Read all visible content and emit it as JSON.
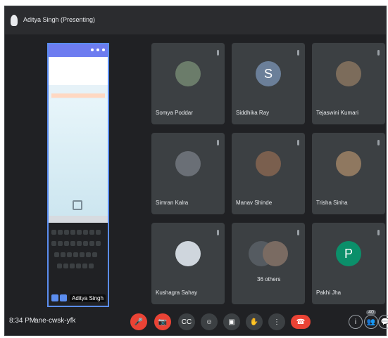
{
  "header": {
    "presenter_label": "Aditya Singh (Presenting)"
  },
  "stage": {
    "label": "Aditya Singh"
  },
  "participants": [
    {
      "name": "Somya Poddar",
      "avatar_color": "#6b7c6a"
    },
    {
      "name": "Siddhika Ray",
      "avatar_letter": "S",
      "avatar_color": "#6b7f99"
    },
    {
      "name": "Tejaswini Kumari",
      "avatar_color": "#7c6c5b"
    },
    {
      "name": "Simran Kalra",
      "avatar_color": "#6a6f76"
    },
    {
      "name": "Manav Shinde",
      "avatar_color": "#7a5f4e"
    },
    {
      "name": "Trisha Sinha",
      "avatar_color": "#8f7860"
    },
    {
      "name": "Kushagra Sahay",
      "avatar_color": "#cfd6dd"
    },
    {
      "others_label": "36 others",
      "avatar_color": "#555b61"
    },
    {
      "name": "Pakhi Jha",
      "avatar_letter": "P",
      "avatar_color": "#0b8f6a"
    }
  ],
  "footer": {
    "time": "8:34 PM",
    "meeting_code": "ane-cwsk-yfk"
  },
  "controls": [
    {
      "name": "mic-toggle",
      "icon": "mic-off-icon",
      "color": "#ea4335"
    },
    {
      "name": "camera-toggle",
      "icon": "camera-off-icon",
      "color": "#ea4335"
    },
    {
      "name": "captions",
      "icon": "captions-icon"
    },
    {
      "name": "emoji",
      "icon": "emoji-icon"
    },
    {
      "name": "present",
      "icon": "present-icon"
    },
    {
      "name": "raise-hand",
      "icon": "hand-icon"
    },
    {
      "name": "more",
      "icon": "more-icon"
    },
    {
      "name": "leave-call",
      "icon": "hangup-icon",
      "color": "#ea4335"
    }
  ],
  "right_controls": {
    "info_icon": "info-icon",
    "people_icon": "people-icon",
    "chat_icon": "chat-icon",
    "people_count": "40"
  }
}
